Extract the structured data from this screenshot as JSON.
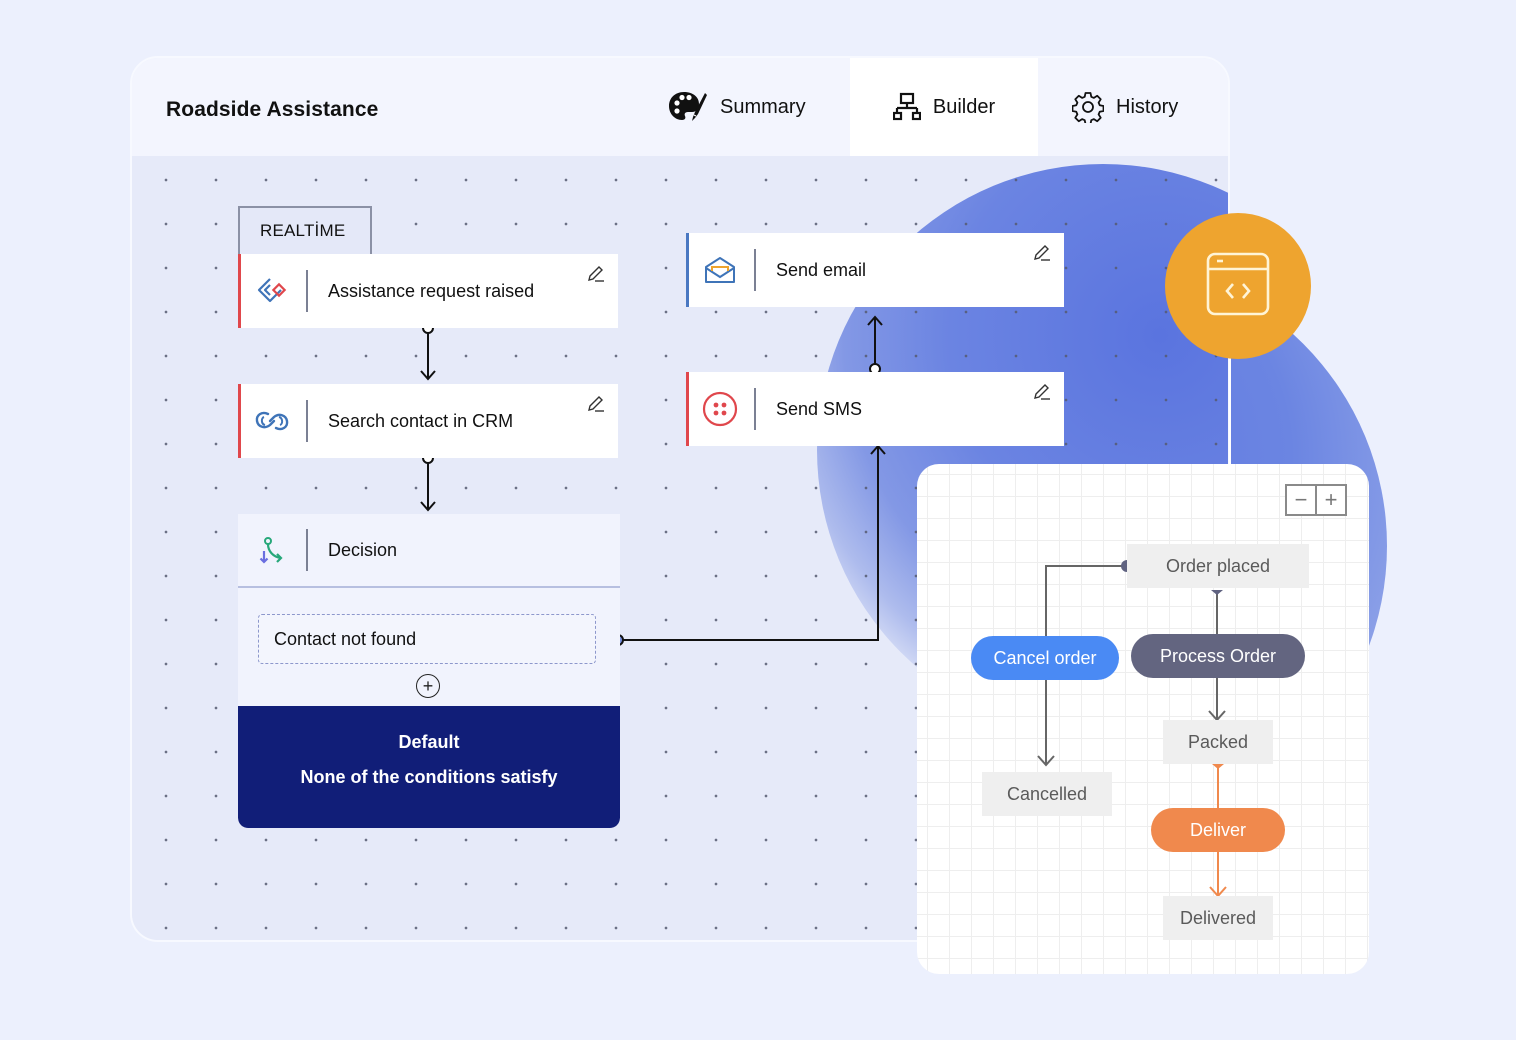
{
  "app": {
    "title": "Roadside Assistance"
  },
  "tabs": [
    {
      "label": "Summary",
      "icon": "palette-icon",
      "active": false
    },
    {
      "label": "Builder",
      "icon": "sitemap-icon",
      "active": true
    },
    {
      "label": "History",
      "icon": "gear-icon",
      "active": false
    }
  ],
  "workflow": {
    "trigger_tag": "REALTİME",
    "nodes": {
      "trigger": {
        "label": "Assistance request raised",
        "icon": "zoho-flow-icon",
        "accent": "#e0474c"
      },
      "crm": {
        "label": "Search contact in CRM",
        "icon": "zoho-crm-icon",
        "accent": "#e0474c"
      },
      "decision": {
        "label": "Decision",
        "icon": "branch-icon"
      },
      "email": {
        "label": "Send email",
        "icon": "email-icon",
        "accent": "#4a78c2"
      },
      "sms": {
        "label": "Send SMS",
        "icon": "sms-icon",
        "accent": "#e0474c"
      }
    },
    "decision": {
      "condition": "Contact not found",
      "add_symbol": "+",
      "default_title": "Default",
      "default_subtitle": "None of the conditions satisfy"
    }
  },
  "badge": {
    "icon": "code-window-icon",
    "color": "#eea42f"
  },
  "status_panel": {
    "zoom_out": "−",
    "zoom_in": "+",
    "states": {
      "order_placed": "Order placed",
      "packed": "Packed",
      "cancelled": "Cancelled",
      "delivered": "Delivered"
    },
    "transitions": {
      "cancel_order": {
        "label": "Cancel order",
        "color": "#4a8af4"
      },
      "process_order": {
        "label": "Process Order",
        "color": "#636580"
      },
      "deliver": {
        "label": "Deliver",
        "color": "#f0894d"
      }
    }
  }
}
